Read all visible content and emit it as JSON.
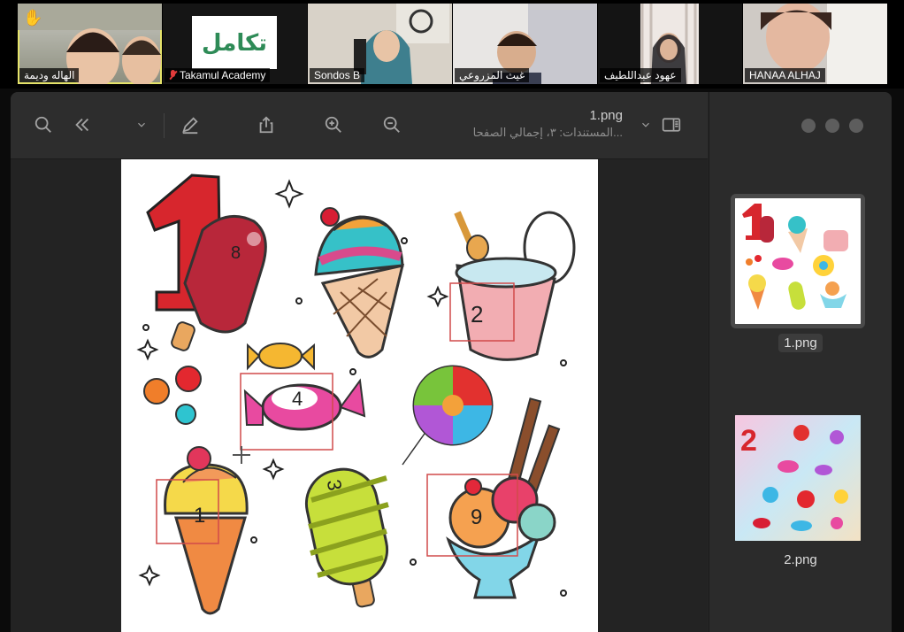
{
  "participants": [
    {
      "name": "الهاله وديمة",
      "active": true,
      "raised_hand": true
    },
    {
      "name": "Takamul Academy",
      "muted": true,
      "logo_text": "تكامل"
    },
    {
      "name": "Sondos B"
    },
    {
      "name": "غيث المزروعي"
    },
    {
      "name": "عهود عبداللطيف"
    },
    {
      "name": "HANAA ALHAJ"
    }
  ],
  "viewer": {
    "file_name": "1.png",
    "subtitle": "المستندات: ٣، إجمالي الصفحا...",
    "toolbar_icons": [
      "search-icon",
      "double-chevron-left-icon",
      "chevron-down-icon",
      "pencil-icon",
      "share-icon",
      "zoom-in-icon",
      "zoom-out-icon",
      "chevron-down-icon",
      "sidebar-icon"
    ]
  },
  "page_numbers": [
    "1",
    "8",
    "2",
    "4",
    "3",
    "1",
    "9"
  ],
  "thumbnails": [
    {
      "label": "1.png",
      "selected": true
    },
    {
      "label": "2.png",
      "selected": false
    }
  ]
}
